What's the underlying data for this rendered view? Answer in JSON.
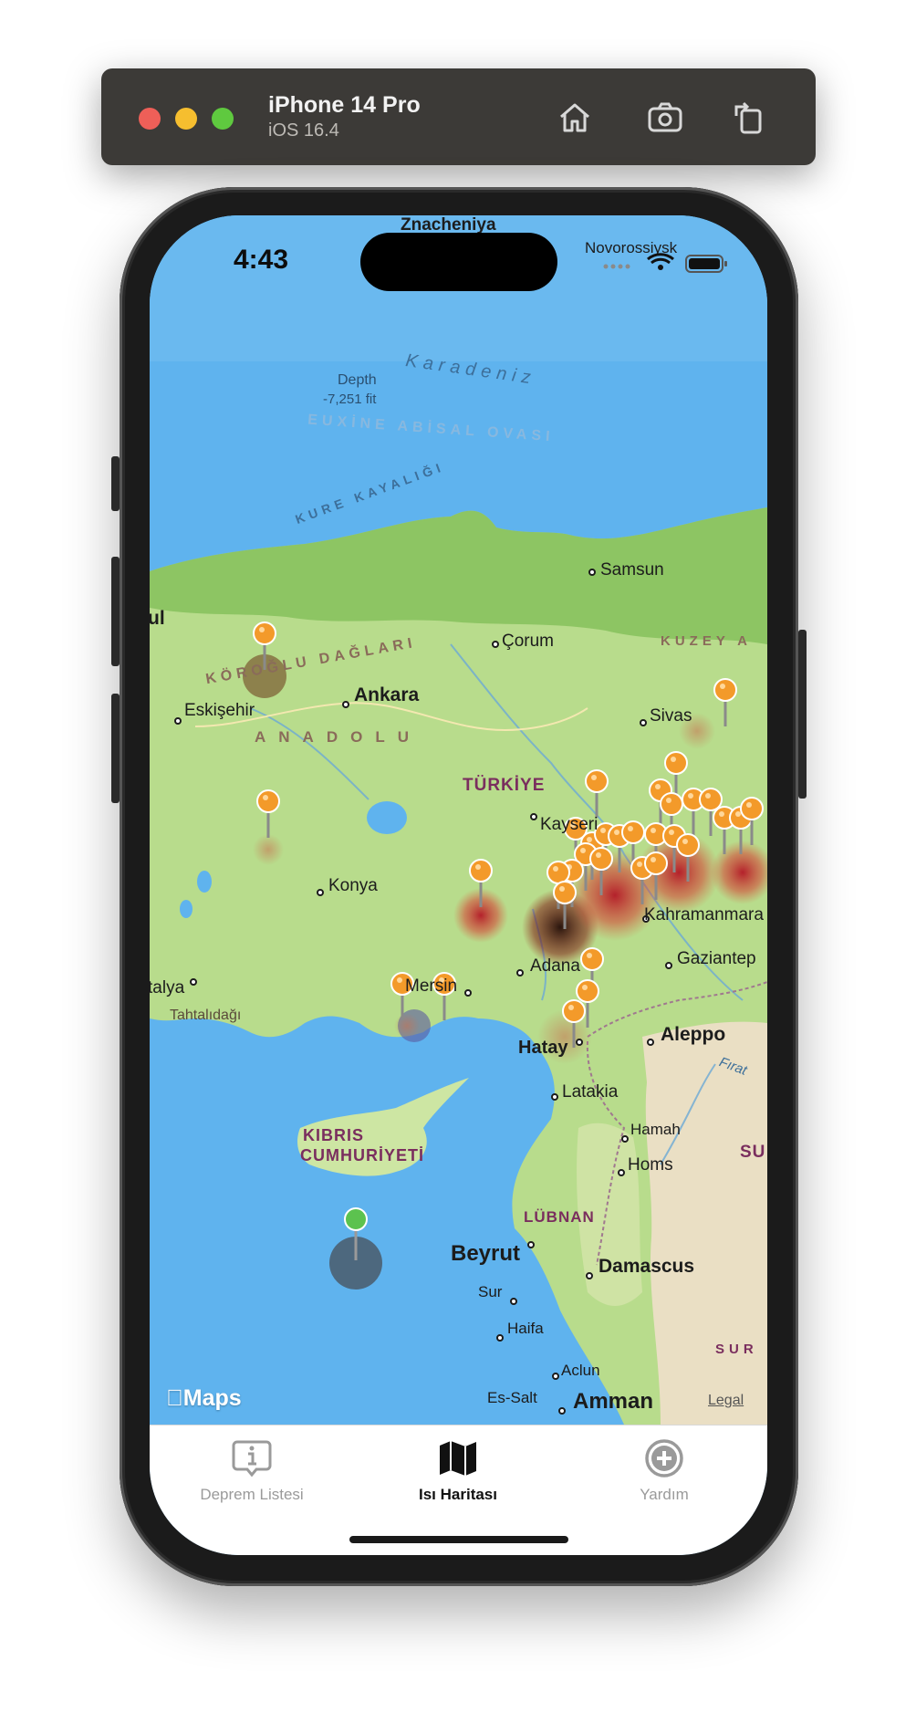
{
  "simulator": {
    "device_name": "iPhone 14 Pro",
    "os_version": "iOS 16.4",
    "icons": [
      "home-icon",
      "screenshot-icon",
      "rotate-icon"
    ]
  },
  "status_bar": {
    "time": "4:43"
  },
  "map": {
    "labels": {
      "znacheniya": "Znacheniya",
      "novorossiysk": "Novorossiysk",
      "depth_title": "Depth",
      "depth_value": "-7,251 fit",
      "karadeniz": "Karadeniz",
      "euxine": "EUXİNE ABİSAL OVASI",
      "kure": "KURE KAYALIĞI",
      "samsun": "Samsun",
      "istanbul_partial": "ul",
      "corum": "Çorum",
      "kuzey": "KUZEY A",
      "koroglu": "KÖROĞLU DAĞLARI",
      "ankara": "Ankara",
      "eskisehir": "Eskişehir",
      "sivas": "Sivas",
      "anadolu": "ANADOLU",
      "turkiye": "TÜRKİYE",
      "kayseri": "Kayseri",
      "konya": "Konya",
      "kahramanmaras": "Kahramanmara",
      "adana": "Adana",
      "gaziantep": "Gaziantep",
      "antalya_partial": "talya",
      "tahtalidagi": "Tahtalıdağı",
      "mersin": "Mersin",
      "hatay": "Hatay",
      "aleppo": "Aleppo",
      "firat": "Fırat",
      "latakia": "Latakia",
      "hamah": "Hamah",
      "kibris_1": "KIBRIS",
      "kibris_2": "CUMHURİYETİ",
      "homs": "Homs",
      "su": "SU",
      "lubnan": "LÜBNAN",
      "beyrut": "Beyrut",
      "damascus": "Damascus",
      "sur": "Sur",
      "haifa": "Haifa",
      "sur_2": "SUR",
      "aclun": "Aclun",
      "es_salt": "Es-Salt",
      "amman": "Amman"
    },
    "attribution": "Maps",
    "legal": "Legal"
  },
  "tabs": [
    {
      "label": "Deprem Listesi",
      "icon": "info-icon",
      "active": false
    },
    {
      "label": "Isı Haritası",
      "icon": "map-icon",
      "active": true
    },
    {
      "label": "Yardım",
      "icon": "plus-circle-icon",
      "active": false
    }
  ]
}
